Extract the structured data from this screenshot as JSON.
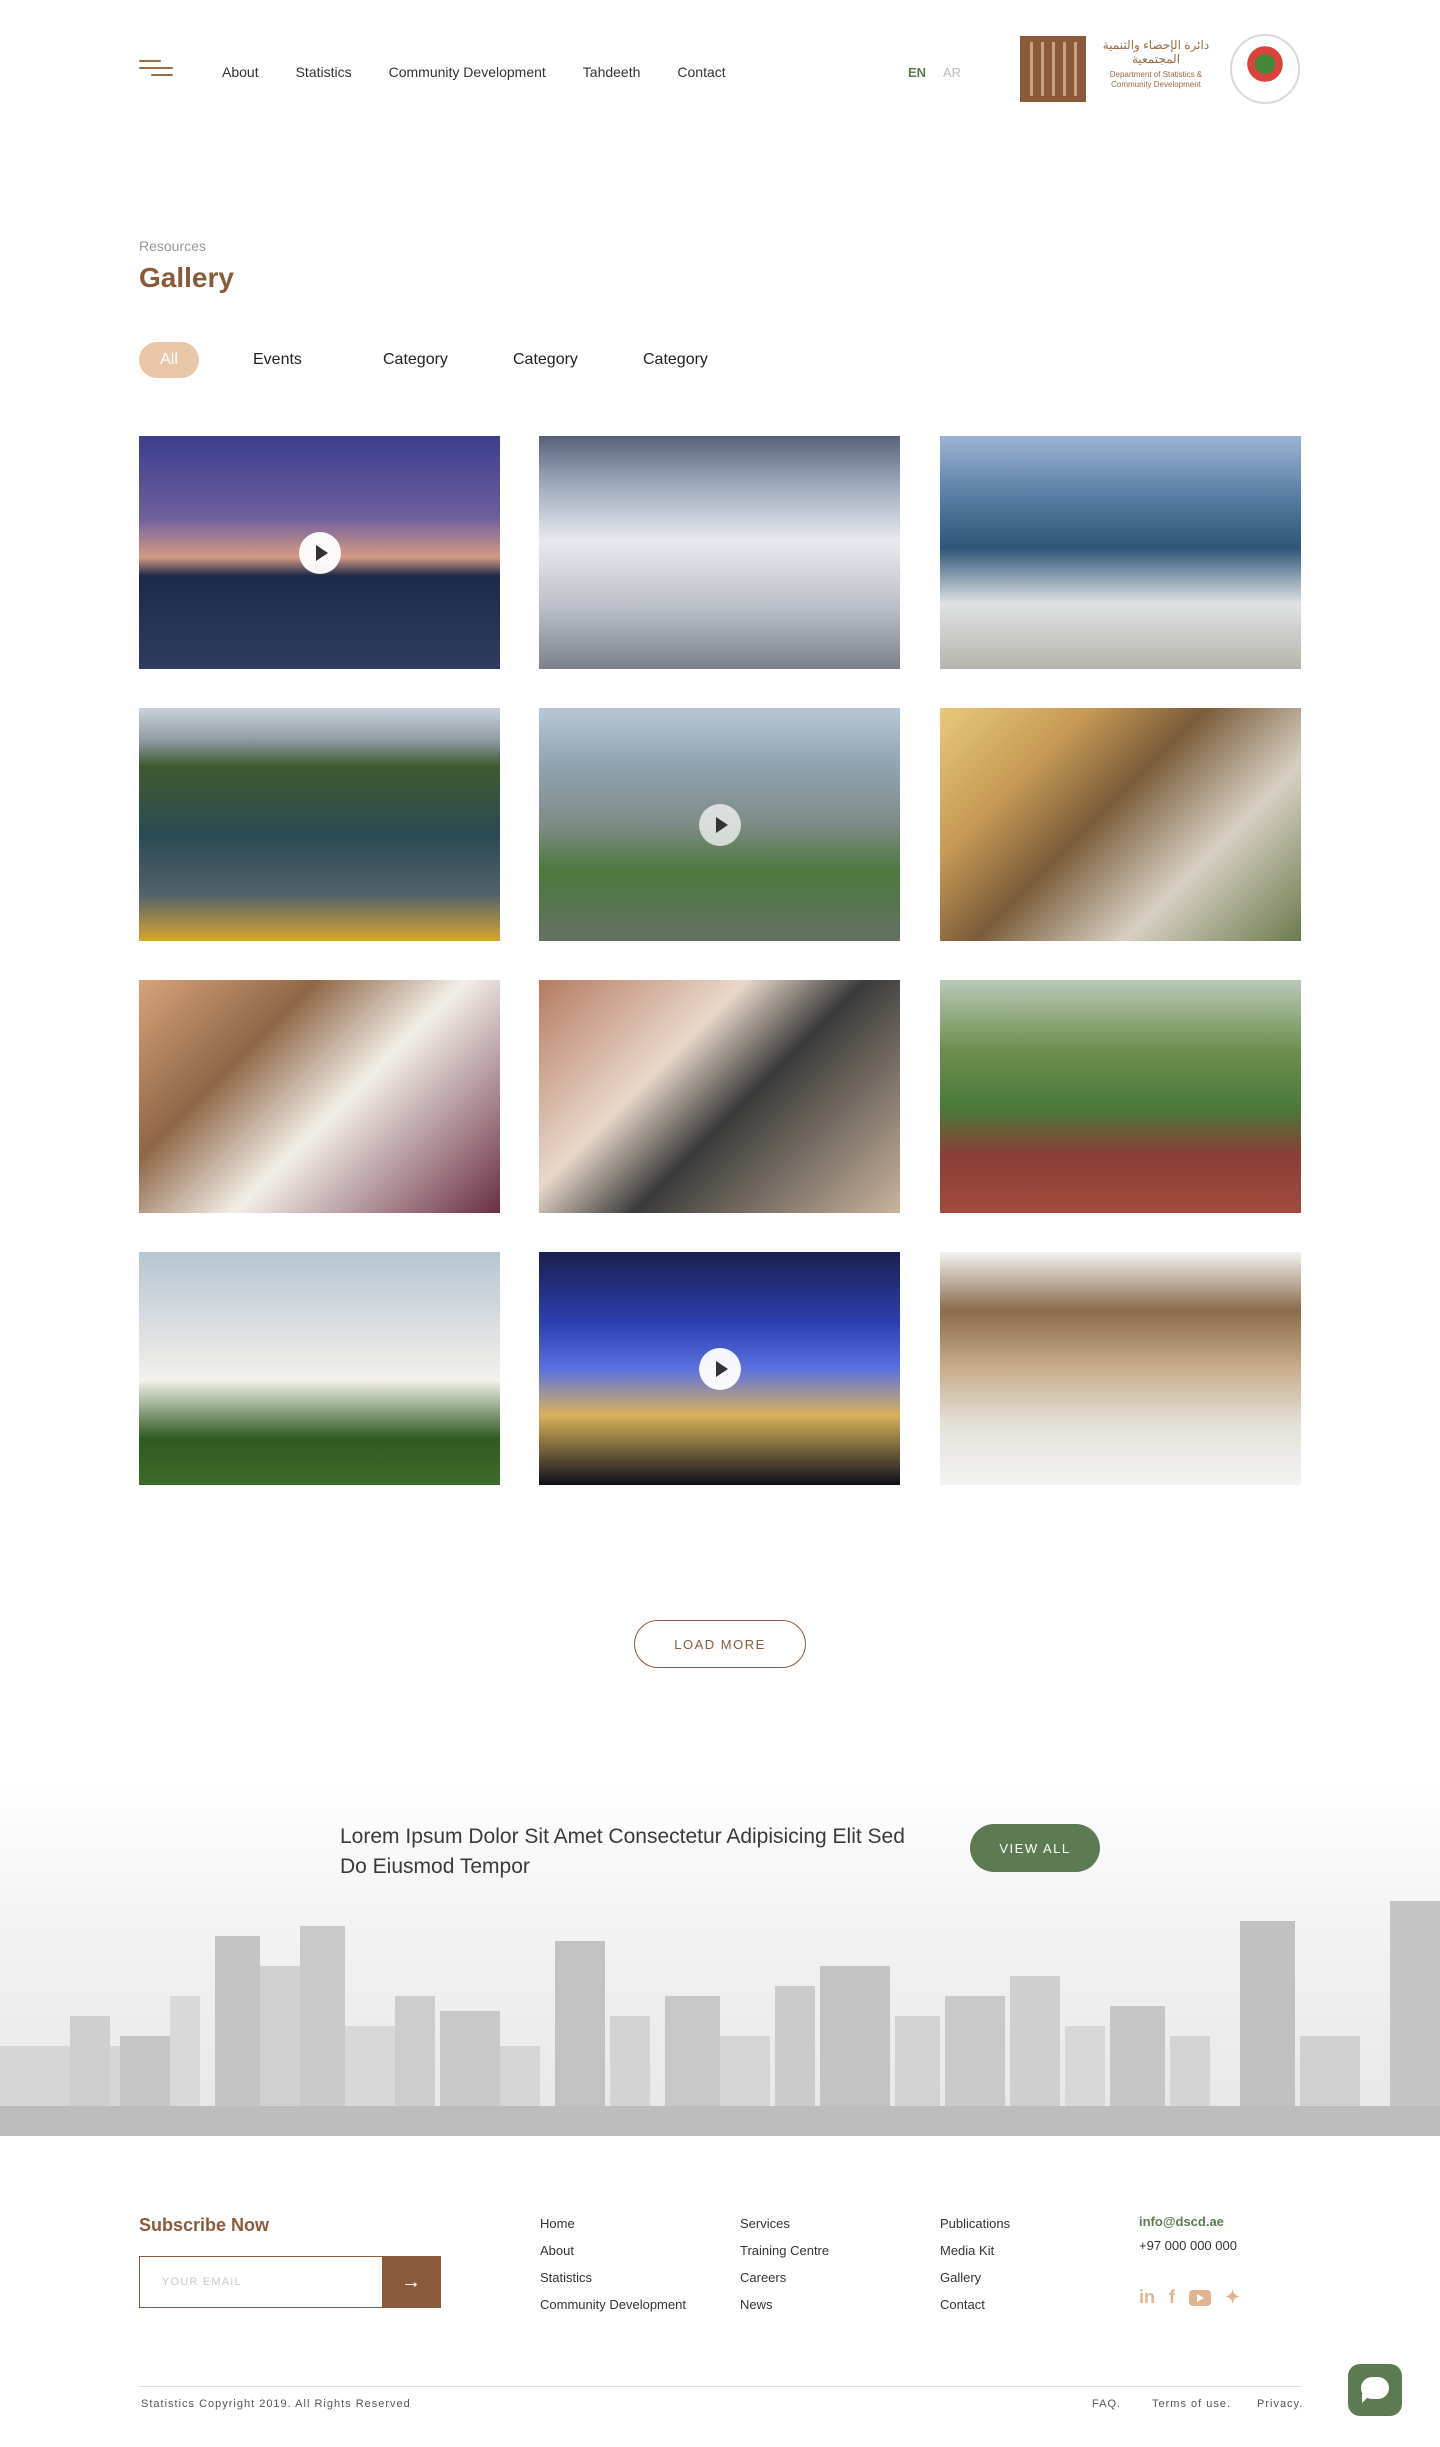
{
  "header": {
    "nav": [
      "About",
      "Statistics",
      "Community Development",
      "Tahdeeth",
      "Contact"
    ],
    "lang_en": "EN",
    "lang_ar": "AR",
    "logo_ar": "دائرة الإحصاء والتنمية المجتمعية",
    "logo_en": "Department of Statistics & Community Development"
  },
  "page": {
    "breadcrumb": "Resources",
    "title": "Gallery"
  },
  "filters": [
    "All",
    "Events",
    "Category",
    "Category",
    "Category"
  ],
  "gallery": {
    "tiles": [
      {
        "subject": "night waterfront",
        "video": true
      },
      {
        "subject": "museum exhibit",
        "video": false
      },
      {
        "subject": "lagoon mosque",
        "video": false
      },
      {
        "subject": "kayaks mangroves",
        "video": false
      },
      {
        "subject": "highway aerial",
        "video": true
      },
      {
        "subject": "cafe terrace",
        "video": false
      },
      {
        "subject": "calligraphy child",
        "video": false
      },
      {
        "subject": "crafts workshop",
        "video": false
      },
      {
        "subject": "park joggers",
        "video": false
      },
      {
        "subject": "white tower",
        "video": false
      },
      {
        "subject": "light tunnel",
        "video": true
      },
      {
        "subject": "heritage courtyard",
        "video": false
      }
    ]
  },
  "load_more": "LOAD MORE",
  "cta": {
    "text": "Lorem Ipsum Dolor Sit Amet Consectetur Adipisicing Elit Sed Do Eiusmod Tempor",
    "button": "VIEW ALL"
  },
  "footer": {
    "subscribe_title": "Subscribe Now",
    "email_placeholder": "YOUR EMAIL",
    "col1": [
      "Home",
      "About",
      "Statistics",
      "Community Development"
    ],
    "col2": [
      "Services",
      "Training Centre",
      "Careers",
      "News"
    ],
    "col3": [
      "Publications",
      "Media Kit",
      "Gallery",
      "Contact"
    ],
    "email": "info@dscd.ae",
    "phone": "+97 000 000 000",
    "socials": [
      "linkedin-icon",
      "facebook-icon",
      "youtube-icon",
      "twitter-icon"
    ],
    "copyright": "Statistics Copyright 2019. All Rights Reserved",
    "faq": "FAQ.",
    "terms": "Terms of use.",
    "privacy": "Privacy."
  },
  "colors": {
    "brand_brown": "#8a5a3b",
    "accent_green": "#5d7b52",
    "filter_active": "#e9c6a7",
    "social": "#e0b48f"
  }
}
